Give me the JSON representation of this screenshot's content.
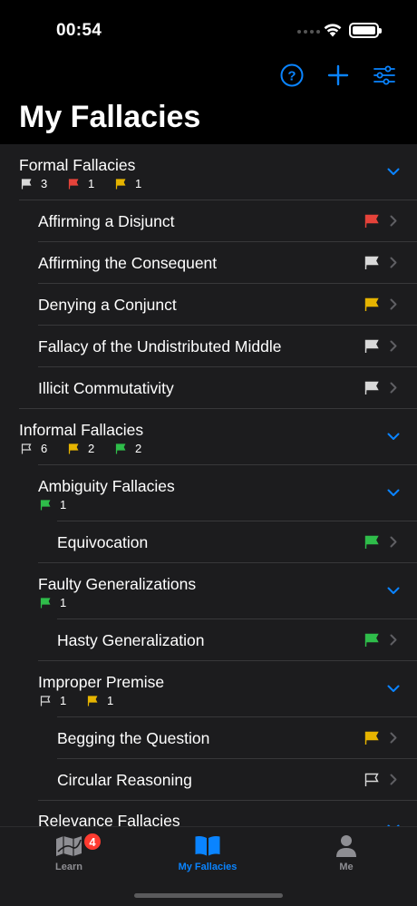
{
  "status_bar": {
    "time": "00:54"
  },
  "toolbar": {
    "help_icon": "question-circle-icon",
    "add_icon": "plus-icon",
    "filter_icon": "sliders-icon"
  },
  "page_title": "My Fallacies",
  "colors": {
    "accent": "#0a84ff",
    "flag_red": "#e5433a",
    "flag_yellow": "#e6b400",
    "flag_green": "#2fbd4a",
    "flag_white": "#d9d9d9",
    "flag_outline": "#d9d9d9"
  },
  "sections": {
    "formal": {
      "title": "Formal Fallacies",
      "counts": {
        "white": "3",
        "red": "1",
        "yellow": "1"
      },
      "items": [
        {
          "label": "Affirming a Disjunct",
          "flag": "red"
        },
        {
          "label": "Affirming the Consequent",
          "flag": "white"
        },
        {
          "label": "Denying a Conjunct",
          "flag": "yellow"
        },
        {
          "label": "Fallacy of the Undistributed Middle",
          "flag": "white"
        },
        {
          "label": "Illicit Commutativity",
          "flag": "white"
        }
      ]
    },
    "informal": {
      "title": "Informal Fallacies",
      "counts": {
        "outline": "6",
        "yellow": "2",
        "green": "2"
      },
      "ambiguity": {
        "title": "Ambiguity Fallacies",
        "counts": {
          "green": "1"
        },
        "items": [
          {
            "label": "Equivocation",
            "flag": "green"
          }
        ]
      },
      "faulty": {
        "title": "Faulty Generalizations",
        "counts": {
          "green": "1"
        },
        "items": [
          {
            "label": "Hasty Generalization",
            "flag": "green"
          }
        ]
      },
      "improper": {
        "title": "Improper Premise",
        "counts": {
          "outline": "1",
          "yellow": "1"
        },
        "items": [
          {
            "label": "Begging the Question",
            "flag": "yellow"
          },
          {
            "label": "Circular Reasoning",
            "flag": "outline"
          }
        ]
      },
      "relevance": {
        "title": "Relevance Fallacies"
      }
    }
  },
  "tabbar": {
    "learn": {
      "label": "Learn",
      "badge": "4",
      "icon": "map-icon"
    },
    "my_fallacies": {
      "label": "My Fallacies",
      "icon": "book-icon"
    },
    "me": {
      "label": "Me",
      "icon": "person-icon"
    }
  }
}
